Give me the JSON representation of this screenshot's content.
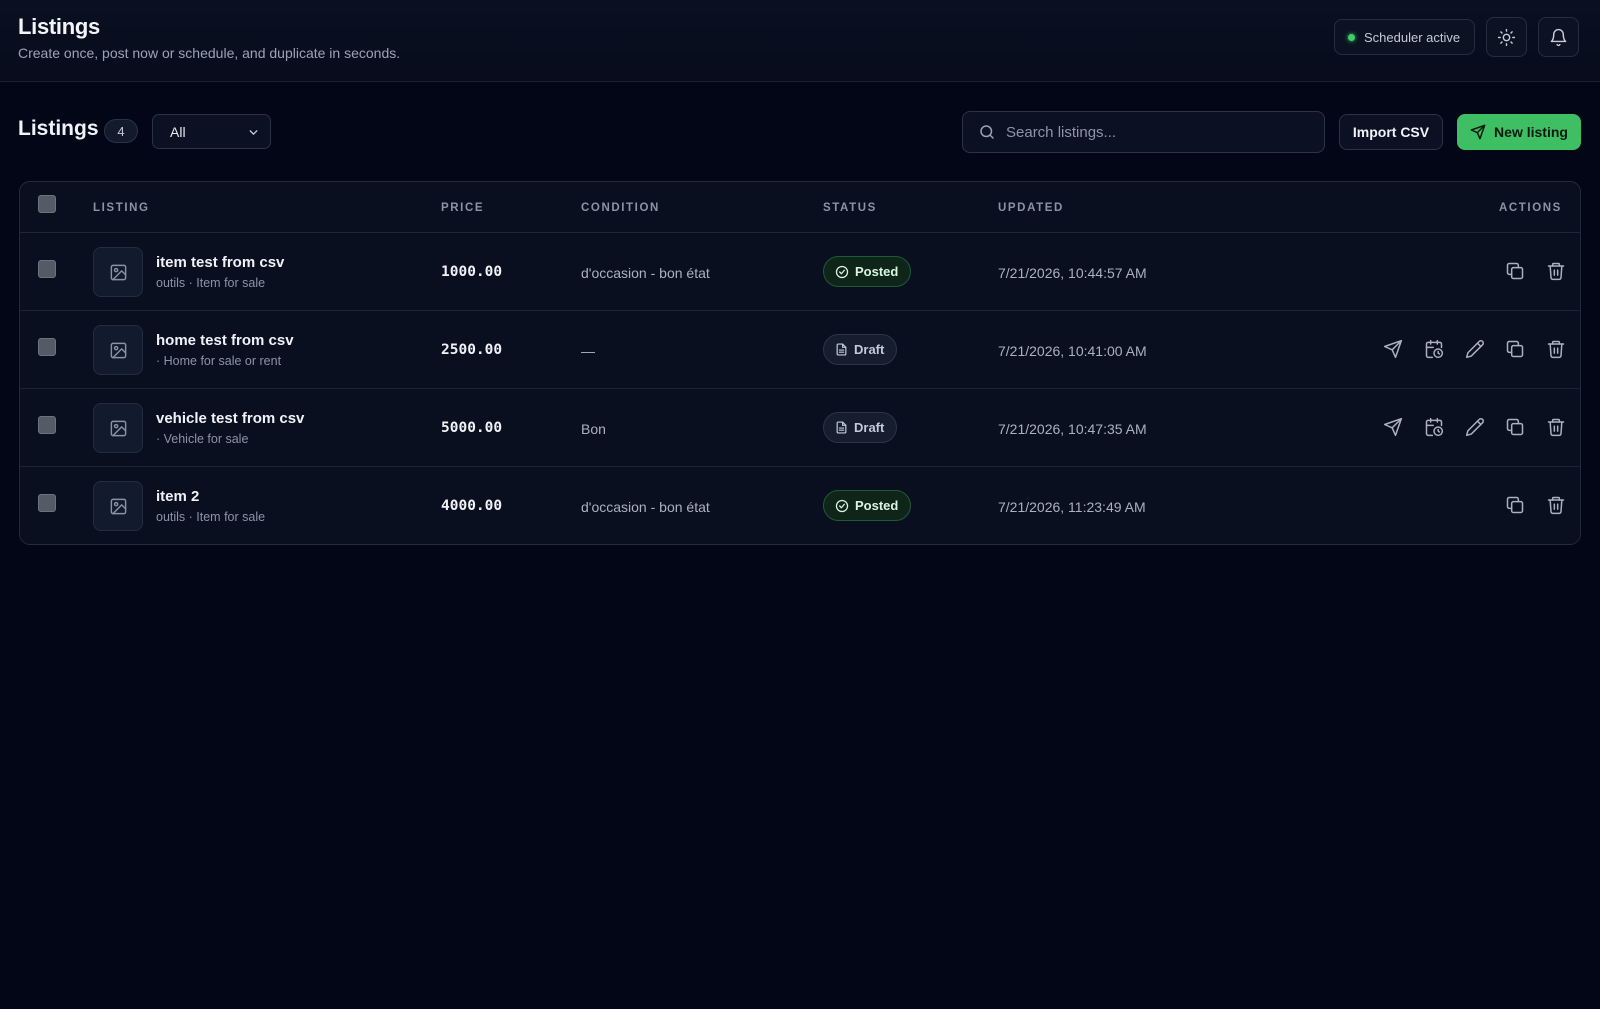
{
  "header": {
    "title": "Listings",
    "subtitle": "Create once, post now or schedule, and duplicate in seconds.",
    "scheduler_label": "Scheduler active",
    "theme_icon": "sun-icon",
    "notifications_icon": "bell-icon"
  },
  "toolbar": {
    "heading": "Listings",
    "count": "4",
    "filter_value": "All",
    "search_placeholder": "Search listings...",
    "import_label": "Import CSV",
    "new_label": "New listing"
  },
  "table": {
    "columns": {
      "listing": "LISTING",
      "price": "PRICE",
      "condition": "CONDITION",
      "status": "STATUS",
      "updated": "UPDATED",
      "actions": "ACTIONS"
    },
    "rows": [
      {
        "title": "item test from csv",
        "subtitle": "outils · Item for sale",
        "price": "1000.00",
        "condition": "d'occasion - bon état",
        "status": "Posted",
        "updated": "7/21/2026, 10:44:57 AM",
        "actions": [
          "duplicate",
          "delete"
        ]
      },
      {
        "title": "home test from csv",
        "subtitle": "· Home for sale or rent",
        "price": "2500.00",
        "condition": "—",
        "status": "Draft",
        "updated": "7/21/2026, 10:41:00 AM",
        "actions": [
          "post",
          "schedule",
          "edit",
          "duplicate",
          "delete"
        ]
      },
      {
        "title": "vehicle test from csv",
        "subtitle": "· Vehicle for sale",
        "price": "5000.00",
        "condition": "Bon",
        "status": "Draft",
        "updated": "7/21/2026, 10:47:35 AM",
        "actions": [
          "post",
          "schedule",
          "edit",
          "duplicate",
          "delete"
        ]
      },
      {
        "title": "item 2",
        "subtitle": "outils · Item for sale",
        "price": "4000.00",
        "condition": "d'occasion - bon état",
        "status": "Posted",
        "updated": "7/21/2026, 11:23:49 AM",
        "actions": [
          "duplicate",
          "delete"
        ]
      }
    ]
  },
  "colors": {
    "background": "#030617",
    "accent": "#3fbf63",
    "scheduler_dot": "#3ecf68"
  }
}
